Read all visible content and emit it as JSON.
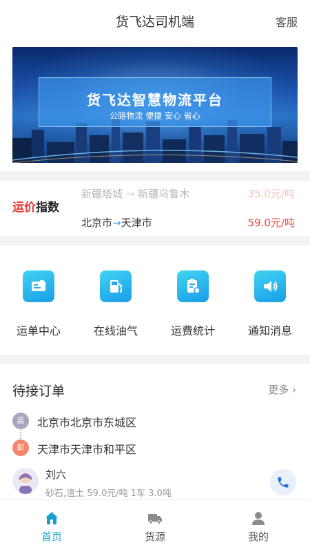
{
  "header": {
    "title": "货飞达司机端",
    "service_label": "客服"
  },
  "banner": {
    "title": "货飞达智慧物流平台",
    "subtitle": "公路物流 便捷 安心 省心"
  },
  "price_index": {
    "logo_red": "运价",
    "logo_black": "指数",
    "rows": [
      {
        "from": "新疆塔城",
        "to": "新疆乌鲁木",
        "price": "35.0元/吨"
      },
      {
        "from": "北京市",
        "to": "天津市",
        "price": "59.0元/吨"
      }
    ]
  },
  "menu": [
    {
      "label": "运单中心",
      "icon": "waybill-icon"
    },
    {
      "label": "在线油气",
      "icon": "fuel-pump-icon"
    },
    {
      "label": "运费统计",
      "icon": "clipboard-stats-icon"
    },
    {
      "label": "通知消息",
      "icon": "speaker-icon"
    }
  ],
  "orders": {
    "title": "待接订单",
    "more_label": "更多",
    "load_tag": "装",
    "unload_tag": "卸",
    "load_address": "北京市北京市东城区",
    "unload_address": "天津市天津市和平区",
    "driver_name": "刘六",
    "cargo_info": "砂石,渣土 59.0元/吨 1车 3.0吨"
  },
  "tabbar": [
    {
      "label": "首页",
      "icon": "home-icon",
      "active": true
    },
    {
      "label": "货源",
      "icon": "truck-icon",
      "active": false
    },
    {
      "label": "我的",
      "icon": "user-icon",
      "active": false
    }
  ],
  "colors": {
    "accent": "#1aa1c8",
    "price_red": "#ee4b3b",
    "icon_blue": "#1a9de8"
  }
}
